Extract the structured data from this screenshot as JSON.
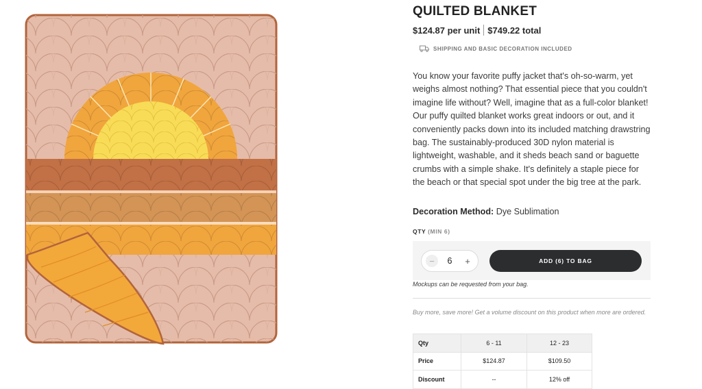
{
  "product": {
    "title": "QUILTED BLANKET",
    "unit_price": "$124.87 per unit",
    "total_price": "$749.22 total",
    "shipping_note": "SHIPPING AND BASIC DECORATION INCLUDED",
    "description": "You know your favorite puffy jacket that's oh-so-warm, yet weighs almost nothing? That essential piece that you couldn't imagine life without? Well, imagine that as a full-color blanket! Our puffy quilted blanket works great indoors or out, and it conveniently packs down into its included matching drawstring bag. The sustainably-produced 30D nylon material is lightweight, washable, and it sheds beach sand or baguette crumbs with a simple shake. It's definitely a staple piece for the beach or that special spot under the big tree at the park.",
    "decoration_label": "Decoration Method:",
    "decoration_value": "Dye Sublimation",
    "image_icon": "quilted-blanket-sunset-image"
  },
  "order": {
    "qty_label": "QTY",
    "qty_min": "(MIN 6)",
    "qty_value": "6",
    "minus_symbol": "−",
    "plus_symbol": "+",
    "add_button": "ADD (6) TO BAG",
    "mockup_note": "Mockups can be requested from your bag."
  },
  "volume_discount": {
    "note": "Buy more, save more! Get a volume discount on this product when more are ordered.",
    "rows": [
      {
        "label": "Qty",
        "values": [
          "6 - 11",
          "12 - 23"
        ]
      },
      {
        "label": "Price",
        "values": [
          "$124.87",
          "$109.50"
        ]
      },
      {
        "label": "Discount",
        "values": [
          "--",
          "12% off"
        ]
      }
    ]
  },
  "colors": {
    "button_dark": "#2c2d2f",
    "blanket_pink": "#e2b8a5",
    "sun_yellow": "#f8dc57",
    "sun_orange": "#f2a43b",
    "stripe_brown": "#c27045"
  }
}
